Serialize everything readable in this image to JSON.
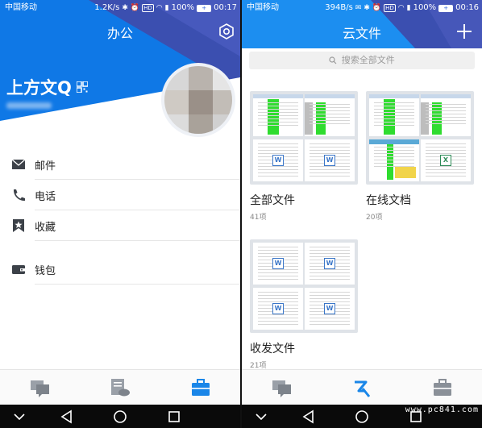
{
  "left": {
    "status": {
      "carrier": "中国移动",
      "speed": "1.2K/s",
      "battery": "100%",
      "time": "00:17"
    },
    "header": {
      "title": "办公"
    },
    "user": {
      "name": "上方文Q"
    },
    "menu": [
      {
        "label": "邮件",
        "icon": "mail-icon"
      },
      {
        "label": "电话",
        "icon": "phone-icon"
      },
      {
        "label": "收藏",
        "icon": "star-bookmark-icon"
      },
      {
        "label": "钱包",
        "icon": "wallet-icon"
      }
    ],
    "tabs": [
      "chat-icon",
      "docs-cloud-icon",
      "briefcase-icon"
    ],
    "active_tab": 2
  },
  "right": {
    "status": {
      "carrier": "中国移动",
      "speed": "394B/s",
      "battery": "100%",
      "time": "00:16"
    },
    "header": {
      "title": "云文件"
    },
    "search": {
      "placeholder": "搜索全部文件"
    },
    "cards": [
      {
        "title": "全部文件",
        "count": "41项"
      },
      {
        "title": "在线文档",
        "count": "20项"
      },
      {
        "title": "收发文件",
        "count": "21项"
      }
    ],
    "tabs": [
      "chat-icon",
      "cloud-files-icon",
      "briefcase-icon"
    ],
    "active_tab": 1
  },
  "watermark": "www.pc841.com",
  "colors": {
    "brand_blue": "#1c8ef0",
    "header_dark": "#3f4fa8",
    "active_tab": "#1a86e8"
  }
}
